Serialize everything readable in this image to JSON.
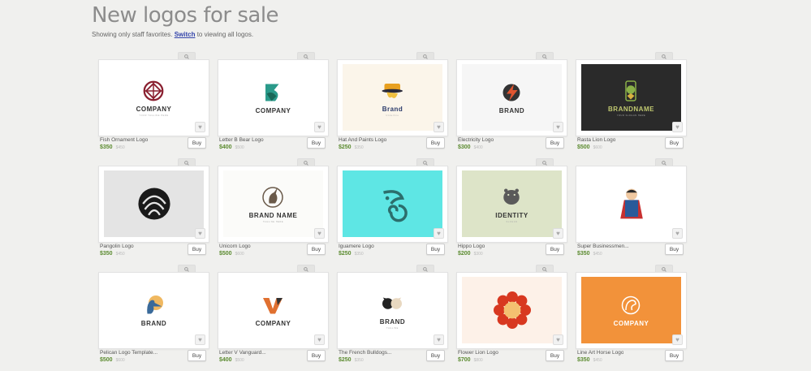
{
  "header": {
    "title": "New logos for sale",
    "subtitle_prefix": "Showing only staff favorites. ",
    "switch_link": "Switch",
    "subtitle_suffix": " to viewing all logos."
  },
  "buy_label": "Buy",
  "fav_glyph": "♥",
  "logos": [
    {
      "name": "Fish Ornament Logo",
      "price": "$350",
      "old_price": "$450",
      "logo_text": "COMPANY",
      "tagline": "YOUR TAGLINE HERE",
      "bg": "#ffffff",
      "accent": "#8a2030",
      "icon": "fish-ornament-icon"
    },
    {
      "name": "Letter B Bear Logo",
      "price": "$400",
      "old_price": "$500",
      "logo_text": "COMPANY",
      "bg": "#ffffff",
      "accent": "#2a9a8a",
      "icon": "letter-b-bear-icon"
    },
    {
      "name": "Hat And Paints Logo",
      "price": "$250",
      "old_price": "$350",
      "logo_text": "Brand",
      "tagline": "Underline",
      "bg": "#fbf5ea",
      "accent": "#e8a020",
      "icon": "hat-paint-icon"
    },
    {
      "name": "Electricity Logo",
      "price": "$300",
      "old_price": "$400",
      "logo_text": "BRAND",
      "bg": "#f6f6f6",
      "accent": "#e05530",
      "icon": "electricity-icon"
    },
    {
      "name": "Rasta Lion Logo",
      "price": "$500",
      "old_price": "$600",
      "logo_text": "BRANDNAME",
      "tagline": "YOUR SLOGAN HERE",
      "bg": "#2a2a2a",
      "accent": "#8ab048",
      "icon": "rasta-lion-icon"
    },
    {
      "name": "Pangolin Logo",
      "price": "$350",
      "old_price": "$450",
      "logo_text": "",
      "bg": "#e4e4e4",
      "accent": "#1a1a1a",
      "icon": "pangolin-icon"
    },
    {
      "name": "Unicorn Logo",
      "price": "$500",
      "old_price": "$600",
      "logo_text": "BRAND NAME",
      "tagline": "TAGLINE HERE",
      "bg": "#fbfbf9",
      "accent": "#6a5a4a",
      "icon": "unicorn-icon"
    },
    {
      "name": "Iguamere Logo",
      "price": "$250",
      "old_price": "$350",
      "logo_text": "",
      "bg": "#5ee6e4",
      "accent": "#2c6e6c",
      "icon": "iguana-icon"
    },
    {
      "name": "Hippo Logo",
      "price": "$200",
      "old_price": "$300",
      "logo_text": "IDENTITY",
      "tagline": "SLOGAN",
      "bg": "#dde4c8",
      "accent": "#5a5a5a",
      "icon": "hippo-icon"
    },
    {
      "name": "Super Businessmen...",
      "price": "$350",
      "old_price": "$450",
      "logo_text": "",
      "bg": "#ffffff",
      "accent": "#2a5a9a",
      "icon": "super-businessman-icon"
    },
    {
      "name": "Pelican Logo Template...",
      "price": "$500",
      "old_price": "$600",
      "logo_text": "BRAND",
      "bg": "#ffffff",
      "accent": "#3a6a9a",
      "icon": "pelican-icon"
    },
    {
      "name": "Letter V Vanguard...",
      "price": "$400",
      "old_price": "$500",
      "logo_text": "COMPANY",
      "bg": "#ffffff",
      "accent": "#e07030",
      "icon": "letter-v-icon"
    },
    {
      "name": "The French Bulldogs...",
      "price": "$250",
      "old_price": "$350",
      "logo_text": "BRAND",
      "tagline": "TAGLINE",
      "bg": "#ffffff",
      "accent": "#222222",
      "icon": "french-bulldogs-icon"
    },
    {
      "name": "Flower Lion Logo",
      "price": "$700",
      "old_price": "$800",
      "logo_text": "",
      "bg": "#fdf1e8",
      "accent": "#d83820",
      "icon": "flower-lion-icon"
    },
    {
      "name": "Line Art Horse Logo",
      "price": "$350",
      "old_price": "$450",
      "logo_text": "COMPANY",
      "bg": "#f2923a",
      "accent": "#ffffff",
      "icon": "line-art-horse-icon"
    }
  ]
}
